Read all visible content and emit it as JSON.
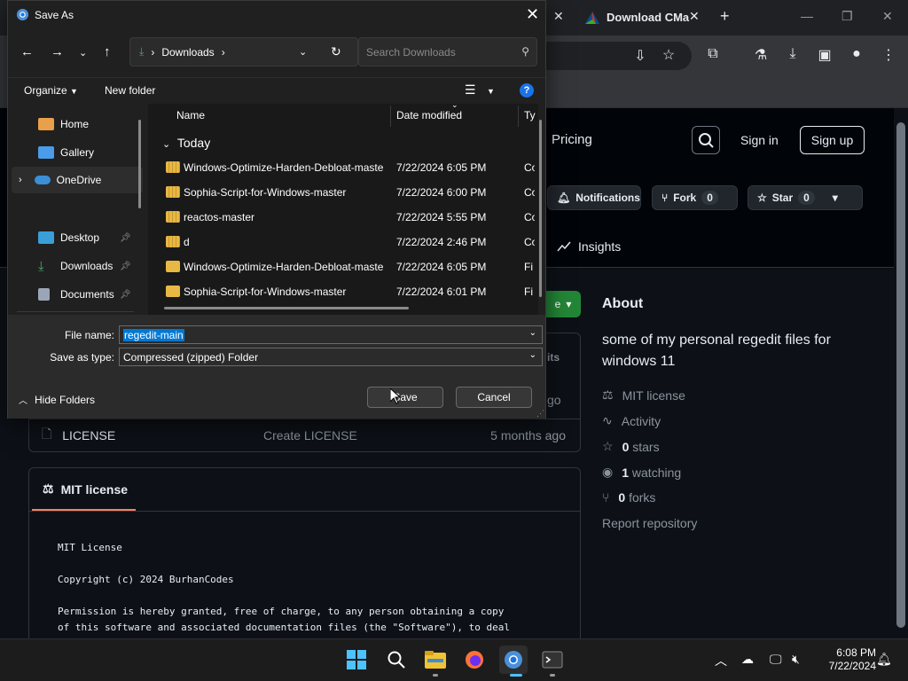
{
  "browser": {
    "tabs": [
      {
        "title": "Download CMa"
      }
    ],
    "new_tab": "+"
  },
  "github": {
    "nav_pricing": "Pricing",
    "sign_in": "Sign in",
    "sign_up": "Sign up",
    "notifications": "Notifications",
    "fork_label": "Fork",
    "fork_count": "0",
    "star_label": "Star",
    "star_count": "0",
    "insights": "Insights",
    "code_peek": "e",
    "commits_peek": "its",
    "ago_peek": "go",
    "files": [
      {
        "name": "LICENSE",
        "message": "Create LICENSE",
        "time": "5 months ago"
      }
    ],
    "about": {
      "title": "About",
      "description": "some of my personal regedit files for windows 11",
      "license": "MIT license",
      "activity": "Activity",
      "stars": "0",
      "stars_label": "stars",
      "watching": "1",
      "watching_label": "watching",
      "forks": "0",
      "forks_label": "forks",
      "report": "Report repository"
    },
    "license_tab": "MIT license",
    "license_lines": [
      "MIT License",
      "Copyright (c) 2024 BurhanCodes",
      "Permission is hereby granted, free of charge, to any person obtaining a copy",
      "of this software and associated documentation files (the \"Software\"), to deal"
    ]
  },
  "dialog": {
    "title": "Save As",
    "address": "Downloads",
    "search_placeholder": "Search Downloads",
    "organize": "Organize",
    "new_folder": "New folder",
    "nav": [
      {
        "label": "Home"
      },
      {
        "label": "Gallery"
      },
      {
        "label": "OneDrive"
      },
      {
        "label": "Desktop"
      },
      {
        "label": "Downloads"
      },
      {
        "label": "Documents"
      }
    ],
    "columns": {
      "name": "Name",
      "date": "Date modified",
      "type": "Ty"
    },
    "group": "Today",
    "files": [
      {
        "name": "Windows-Optimize-Harden-Debloat-master",
        "date": "7/22/2024 6:05 PM",
        "type": "Co"
      },
      {
        "name": "Sophia-Script-for-Windows-master",
        "date": "7/22/2024 6:00 PM",
        "type": "Co"
      },
      {
        "name": "reactos-master",
        "date": "7/22/2024 5:55 PM",
        "type": "Co"
      },
      {
        "name": "d",
        "date": "7/22/2024 2:46 PM",
        "type": "Co"
      },
      {
        "name": "Windows-Optimize-Harden-Debloat-master",
        "date": "7/22/2024 6:05 PM",
        "type": "Fi"
      },
      {
        "name": "Sophia-Script-for-Windows-master",
        "date": "7/22/2024 6:01 PM",
        "type": "Fi"
      }
    ],
    "file_name_label": "File name:",
    "file_name_value": "regedit-main",
    "save_type_label": "Save as type:",
    "save_type_value": "Compressed (zipped) Folder",
    "hide_folders": "Hide Folders",
    "save": "Save",
    "cancel": "Cancel"
  },
  "taskbar": {
    "time": "6:08 PM",
    "date": "7/22/2024"
  }
}
